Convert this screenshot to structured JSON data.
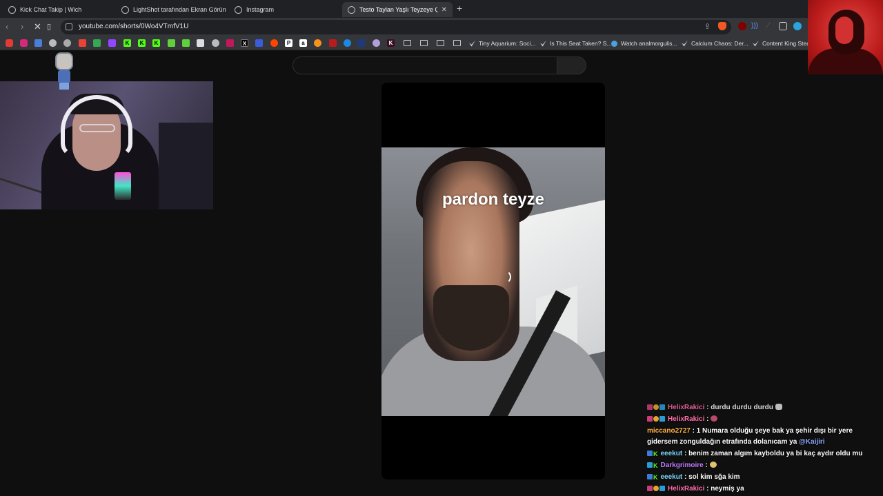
{
  "browser": {
    "tabs": [
      {
        "title": "Kick Chat Takip | Wich"
      },
      {
        "title": "LightShot tarafından Ekran Görüntüs"
      },
      {
        "title": "Instagram"
      },
      {
        "title": "Testo Taylan Yaşlı Teyzeye Çarpıy",
        "active": true
      }
    ],
    "new_tab_label": "+",
    "url": "youtube.com/shorts/0Wo4VTmfV1U"
  },
  "bookmarks": {
    "items": [
      "Tiny Aquarium: Soci...",
      "Is This Seat Taken? S...",
      "Watch analmorgulis...",
      "Calcium Chaos: Der...",
      "Content King Stean"
    ]
  },
  "video": {
    "caption": "pardon teyze"
  },
  "chat": {
    "messages": [
      {
        "user": "HelixRakici",
        "sep": " : ",
        "text": "durdu durdu durdu",
        "color": "pink"
      },
      {
        "user": "HelixRakici",
        "sep": " : ",
        "text": "",
        "color": "pink"
      },
      {
        "user": "miccano2727",
        "sep": " : ",
        "text": "1 Numara olduğu şeye bak ya şehir dışı bir yere gidersem zonguldağın etrafında dolanıcam ya ",
        "mention": "@Kaijiri",
        "color": "orange"
      },
      {
        "user": "eeekut",
        "sep": " : ",
        "text": "benim zaman algım kayboldu ya bi kaç aydır oldu mu",
        "color": "cyan"
      },
      {
        "user": "Darkgrimoire",
        "sep": " : ",
        "text": "",
        "color": "purple"
      },
      {
        "user": "eeekut",
        "sep": " : ",
        "text": "sol kim sğa kim",
        "color": "cyan"
      },
      {
        "user": "HelixRakici",
        "sep": " : ",
        "text": "neymiş ya",
        "color": "pink"
      }
    ]
  }
}
